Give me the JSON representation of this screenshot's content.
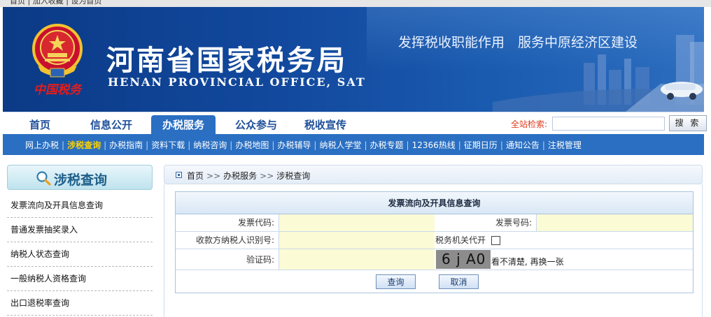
{
  "top_strip": {
    "text": "首页 | 加入收藏 | 设为首页"
  },
  "banner": {
    "logo_script": "中国税务",
    "title": "河南省国家税务局",
    "subtitle": "HENAN PROVINCIAL OFFICE, SAT",
    "slogan": "发挥税收职能作用　服务中原经济区建设"
  },
  "main_nav": {
    "tabs": [
      {
        "label": "首页"
      },
      {
        "label": "信息公开"
      },
      {
        "label": "办税服务",
        "active": true
      },
      {
        "label": "公众参与"
      },
      {
        "label": "税收宣传"
      }
    ],
    "search_label": "全站检索:",
    "search_placeholder": "",
    "search_button": "搜 索"
  },
  "sub_nav": {
    "items": [
      {
        "label": "网上办税"
      },
      {
        "label": "涉税查询",
        "current": true
      },
      {
        "label": "办税指南"
      },
      {
        "label": "资料下载"
      },
      {
        "label": "纳税咨询"
      },
      {
        "label": "办税地图"
      },
      {
        "label": "办税辅导"
      },
      {
        "label": "纳税人学堂"
      },
      {
        "label": "办税专题"
      },
      {
        "label": "12366热线"
      },
      {
        "label": "征期日历"
      },
      {
        "label": "通知公告"
      },
      {
        "label": "注税管理"
      }
    ]
  },
  "sidebar": {
    "title": "涉税查询",
    "items": [
      {
        "label": "发票流向及开具信息查询"
      },
      {
        "label": "普通发票抽奖录入"
      },
      {
        "label": "纳税人状态查询"
      },
      {
        "label": "一般纳税人资格查询"
      },
      {
        "label": "出口退税率查询"
      }
    ]
  },
  "breadcrumb": {
    "items": [
      "首页",
      "办税服务",
      "涉税查询"
    ],
    "separator": ">>"
  },
  "form": {
    "title": "发票流向及开具信息查询",
    "invoice_code_label": "发票代码:",
    "invoice_code_value": "",
    "invoice_number_label": "发票号码:",
    "invoice_number_value": "",
    "payee_id_label": "收款方纳税人识别号:",
    "payee_id_value": "",
    "tax_office_label": "税务机关代开",
    "tax_office_checked": false,
    "captcha_label": "验证码:",
    "captcha_value": "",
    "captcha_text": "6 j A0",
    "captcha_refresh": "看不清楚, 再换一张",
    "query_button": "查询",
    "cancel_button": "取消"
  },
  "colors": {
    "banner_blue": "#12499e",
    "nav_blue": "#2a6fc2",
    "current_link": "#ffd200",
    "search_label": "#e03c1e",
    "input_fill": "#fbfbd6"
  }
}
